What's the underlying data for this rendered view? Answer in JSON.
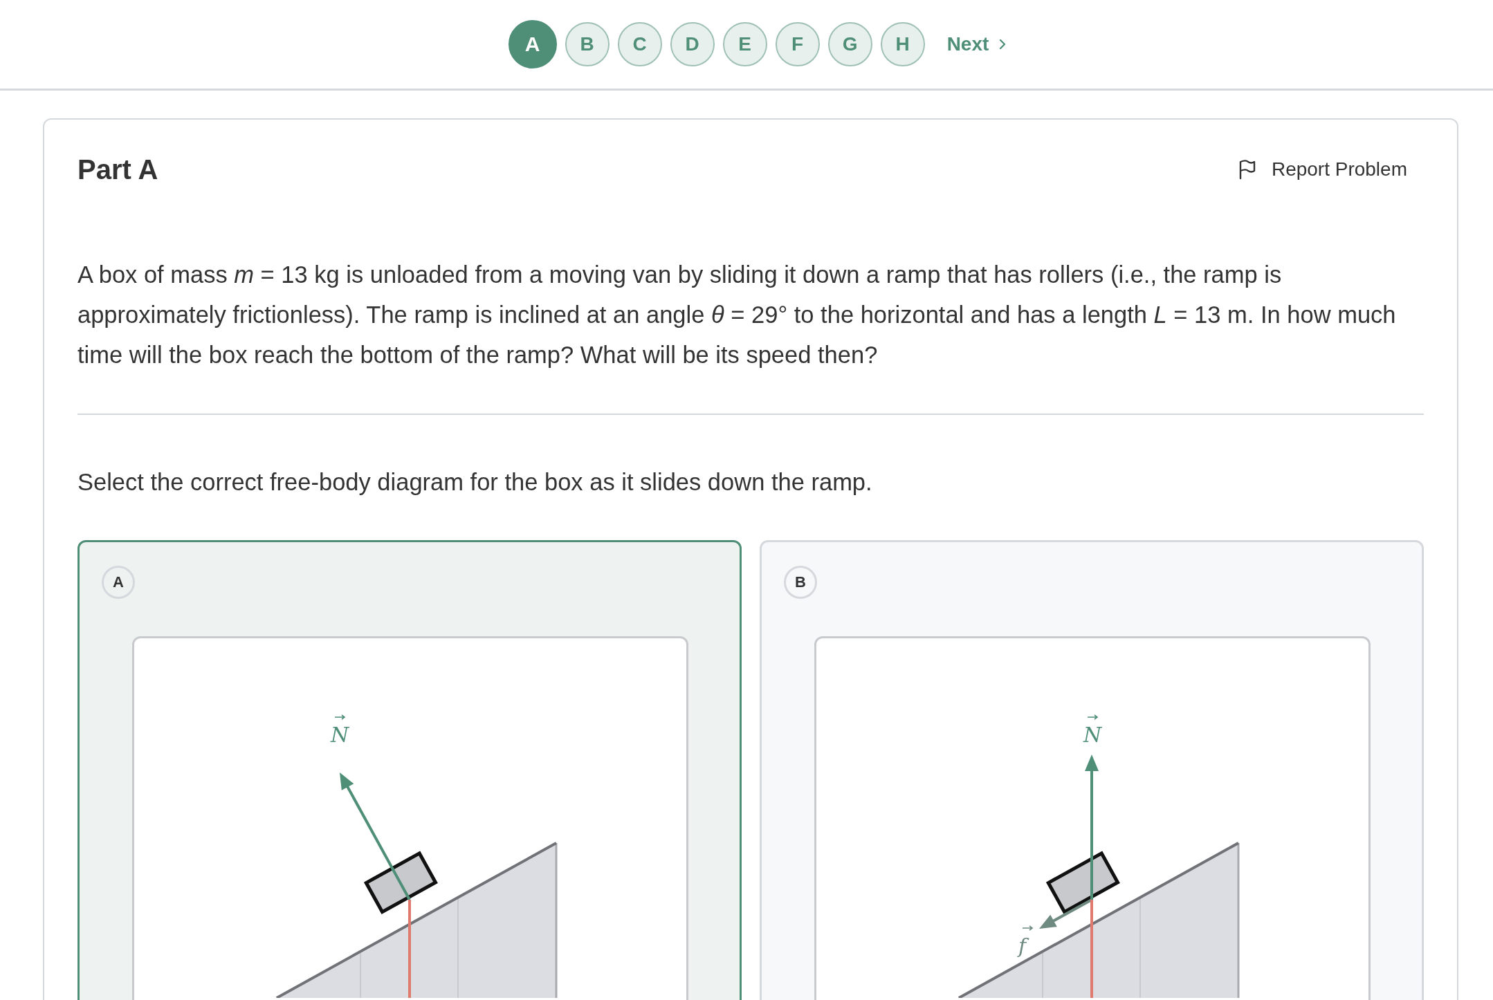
{
  "parts_nav": {
    "items": [
      {
        "label": "A",
        "selected": true
      },
      {
        "label": "B",
        "selected": false
      },
      {
        "label": "C",
        "selected": false
      },
      {
        "label": "D",
        "selected": false
      },
      {
        "label": "E",
        "selected": false
      },
      {
        "label": "F",
        "selected": false
      },
      {
        "label": "G",
        "selected": false
      },
      {
        "label": "H",
        "selected": false
      }
    ],
    "next": "Next"
  },
  "card": {
    "title": "Part A",
    "report": "Report Problem",
    "problem": "A box of mass *m* = 13 kg is unloaded from a moving van by sliding it down a ramp that has rollers (i.e., the ramp is approximately frictionless). The ramp is inclined at an angle *θ* = 29° to the horizontal and has a length *L* = 13 m. In how much time will the box reach the bottom of the ramp? What will be its speed then?",
    "prompt": "Select the correct free-body diagram for the box as it slides down the ramp.",
    "options": [
      {
        "label": "A",
        "selected": true,
        "forces": [
          {
            "kind": "normal",
            "label": "N"
          },
          {
            "kind": "weight"
          }
        ]
      },
      {
        "label": "B",
        "selected": false,
        "forces": [
          {
            "kind": "vertical",
            "label": "N"
          },
          {
            "kind": "friction",
            "label": "f"
          },
          {
            "kind": "weight"
          }
        ]
      }
    ]
  }
}
